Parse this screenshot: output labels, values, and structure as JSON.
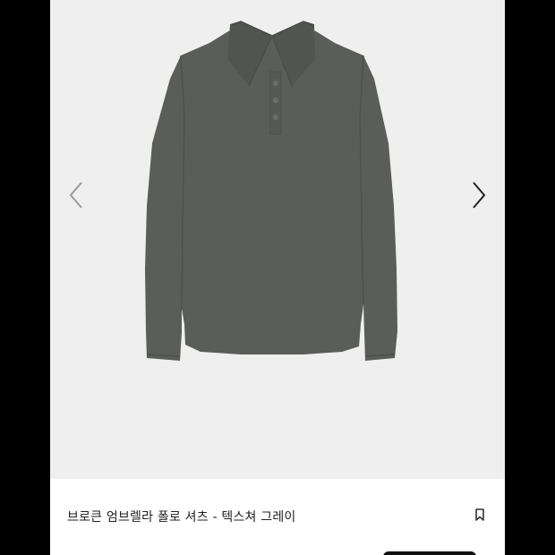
{
  "product": {
    "title": "브로큰 엄브렐라 폴로 셔츠 - 텍스쳐 그레이",
    "image_alt": "gray long-sleeve polo shirt",
    "shirt_color": "#5a5c58"
  },
  "gallery": {
    "background_color": "#efefef",
    "prev_icon": "chevron-left-icon",
    "next_icon": "chevron-right-icon"
  },
  "actions": {
    "bookmark_icon": "bookmark-icon"
  }
}
